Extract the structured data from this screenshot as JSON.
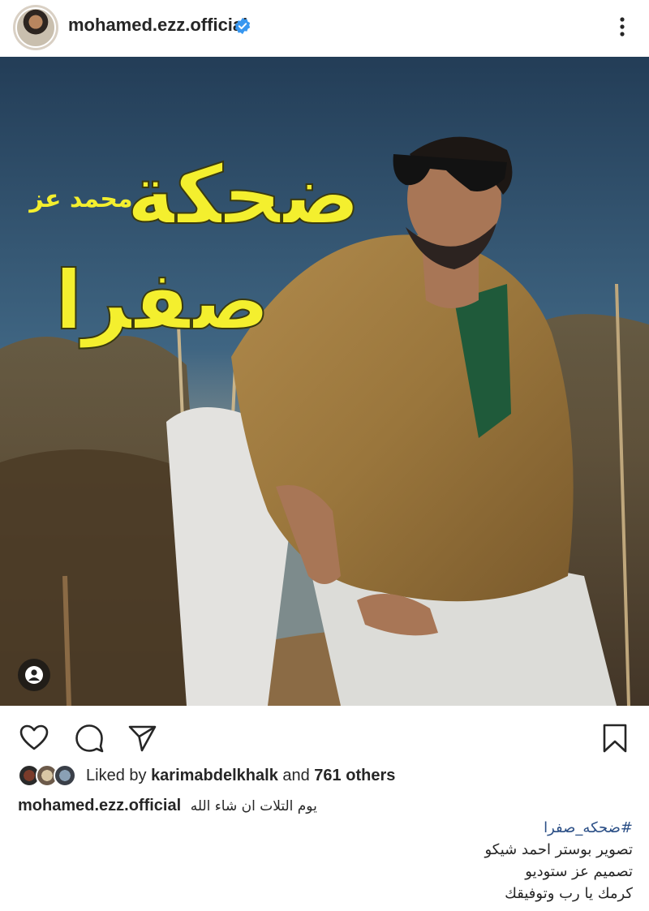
{
  "header": {
    "username": "mohamed.ezz.official",
    "avatar_icon": "profile-avatar",
    "verified_icon": "verified-badge-icon",
    "more_icon": "more-vertical-icon",
    "verified_color": "#3897f0"
  },
  "post": {
    "image_title_line1": "ضحكة",
    "image_title_line2": "صفرا",
    "image_signature": "محمد عز",
    "user_tag_icon": "user-tag-icon",
    "title_color": "#f4ef2e"
  },
  "actions": {
    "like_icon": "heart-icon",
    "comment_icon": "comment-icon",
    "share_icon": "send-icon",
    "save_icon": "bookmark-icon"
  },
  "likes": {
    "prefix": "Liked by ",
    "liked_by": "karimabdelkhalk",
    "middle": " and ",
    "others": "761 others"
  },
  "caption": {
    "username": "mohamed.ezz.official",
    "text": "يوم التلات ان شاء الله",
    "hashtag": "#ضحكه_صفرا",
    "line2": "تصوير بوستر احمد شيكو",
    "line3": "تصميم عز ستوديو",
    "line4": "كرمك يا رب وتوفيقك"
  }
}
